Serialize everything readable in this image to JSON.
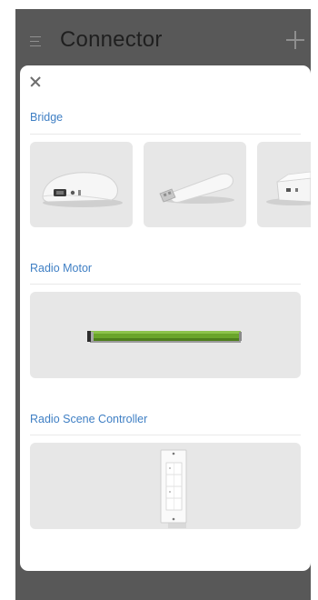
{
  "app": {
    "title": "Connector"
  },
  "header": {
    "menu_icon": "menu-icon",
    "add_icon": "plus-icon"
  },
  "sheet": {
    "close_icon": "close-icon",
    "sections": [
      {
        "label": "Bridge",
        "items": [
          "bridge-device-1",
          "bridge-usb-stick",
          "bridge-device-3"
        ]
      },
      {
        "label": "Radio Motor",
        "items": [
          "radio-motor-tube"
        ]
      },
      {
        "label": "Radio Scene Controller",
        "items": [
          "wall-switch-panel"
        ]
      }
    ]
  },
  "colors": {
    "accent": "#3f7fc4",
    "background_dim": "#585858",
    "card": "#e7e7e7",
    "motor_green": "#6aa52a"
  }
}
